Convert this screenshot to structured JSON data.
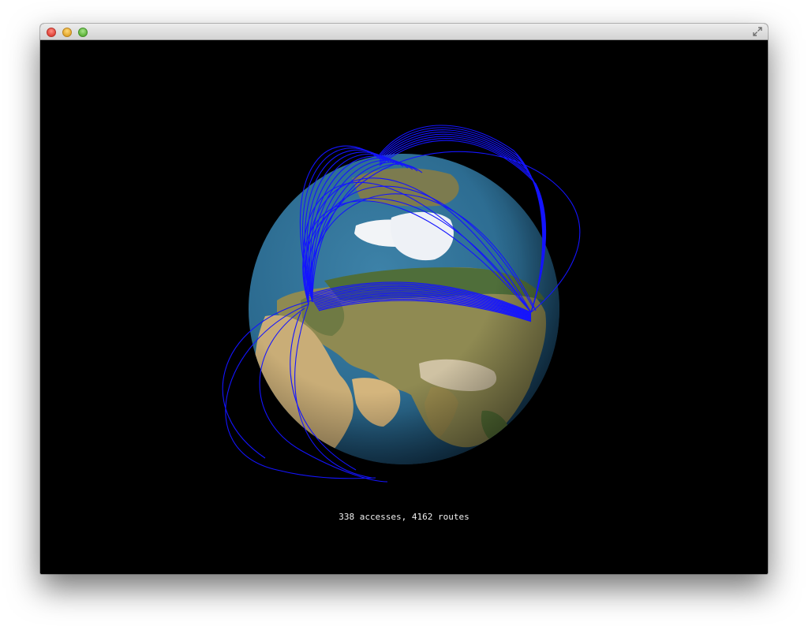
{
  "window": {
    "controls": [
      "close-button",
      "minimize-button",
      "zoom-button"
    ],
    "fullscreen_icon": "fullscreen-icon"
  },
  "scene": {
    "background_color": "#000000",
    "route_color": "#1414ff",
    "ocean_color": "#2c6d94",
    "land_color": "#9b8a55",
    "ice_color": "#f2f4f7"
  },
  "status": {
    "text": "338 accesses, 4162 routes"
  }
}
